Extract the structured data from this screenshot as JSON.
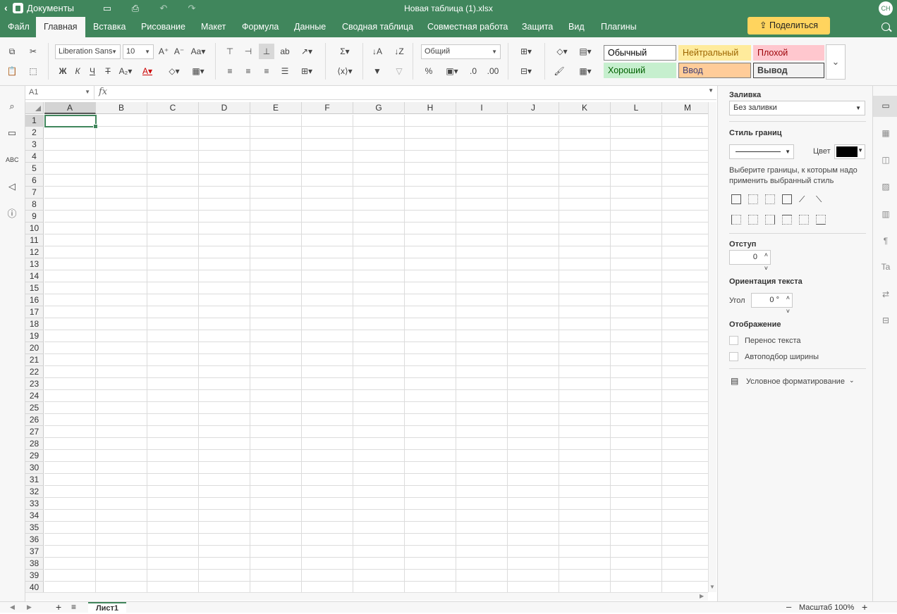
{
  "titlebar": {
    "app_name": "Документы",
    "doc_title": "Новая таблица (1).xlsx",
    "avatar": "CH"
  },
  "tabs": [
    "Файл",
    "Главная",
    "Вставка",
    "Рисование",
    "Макет",
    "Формула",
    "Данные",
    "Сводная таблица",
    "Совместная работа",
    "Защита",
    "Вид",
    "Плагины"
  ],
  "share_label": "Поделиться",
  "toolbar": {
    "font_name": "Liberation Sans",
    "font_size": "10",
    "number_format": "Общий",
    "bold": "Ж",
    "italic": "К",
    "underline": "Ч",
    "strike": "Т",
    "styles": [
      {
        "label": "Обычный",
        "bg": "#ffffff",
        "fg": "#000000",
        "border": "#888888"
      },
      {
        "label": "Нейтральный",
        "bg": "#ffeb9c",
        "fg": "#9c6500",
        "border": "#ffeb9c"
      },
      {
        "label": "Плохой",
        "bg": "#ffc7ce",
        "fg": "#9c0006",
        "border": "#ffc7ce"
      },
      {
        "label": "Хороший",
        "bg": "#c6efce",
        "fg": "#006100",
        "border": "#c6efce"
      },
      {
        "label": "Ввод",
        "bg": "#ffcc99",
        "fg": "#3f3f76",
        "border": "#7f7f7f"
      },
      {
        "label": "Вывод",
        "bg": "#f2f2f2",
        "fg": "#3f3f3f",
        "border": "#3f3f3f"
      }
    ]
  },
  "formula_bar": {
    "cell_ref": "A1",
    "fx": "fx",
    "value": ""
  },
  "columns": [
    "A",
    "B",
    "C",
    "D",
    "E",
    "F",
    "G",
    "H",
    "I",
    "J",
    "K",
    "L",
    "M"
  ],
  "selected": {
    "column": "A",
    "row": 1
  },
  "rows": [
    1,
    2,
    3,
    4,
    5,
    6,
    7,
    8,
    9,
    10,
    11,
    12,
    13,
    14,
    15,
    16,
    17,
    18,
    19,
    20,
    21,
    22,
    23,
    24,
    25,
    26,
    27,
    28,
    29,
    30,
    31,
    32,
    33,
    34,
    35,
    36,
    37,
    38,
    39,
    40
  ],
  "right_panel": {
    "fill_title": "Заливка",
    "fill_value": "Без заливки",
    "border_style_title": "Стиль границ",
    "color_label": "Цвет",
    "border_color": "#000000",
    "border_hint": "Выберите границы, к которым надо применить выбранный стиль",
    "indent_title": "Отступ",
    "indent_value": "0",
    "orientation_title": "Ориентация текста",
    "angle_label": "Угол",
    "angle_value": "0 °",
    "display_title": "Отображение",
    "wrap_label": "Перенос текста",
    "autofit_label": "Автоподбор ширины",
    "cond_format_label": "Условное форматирование"
  },
  "statusbar": {
    "sheet": "Лист1",
    "zoom": "Масштаб 100%"
  },
  "accent": "#40865c"
}
